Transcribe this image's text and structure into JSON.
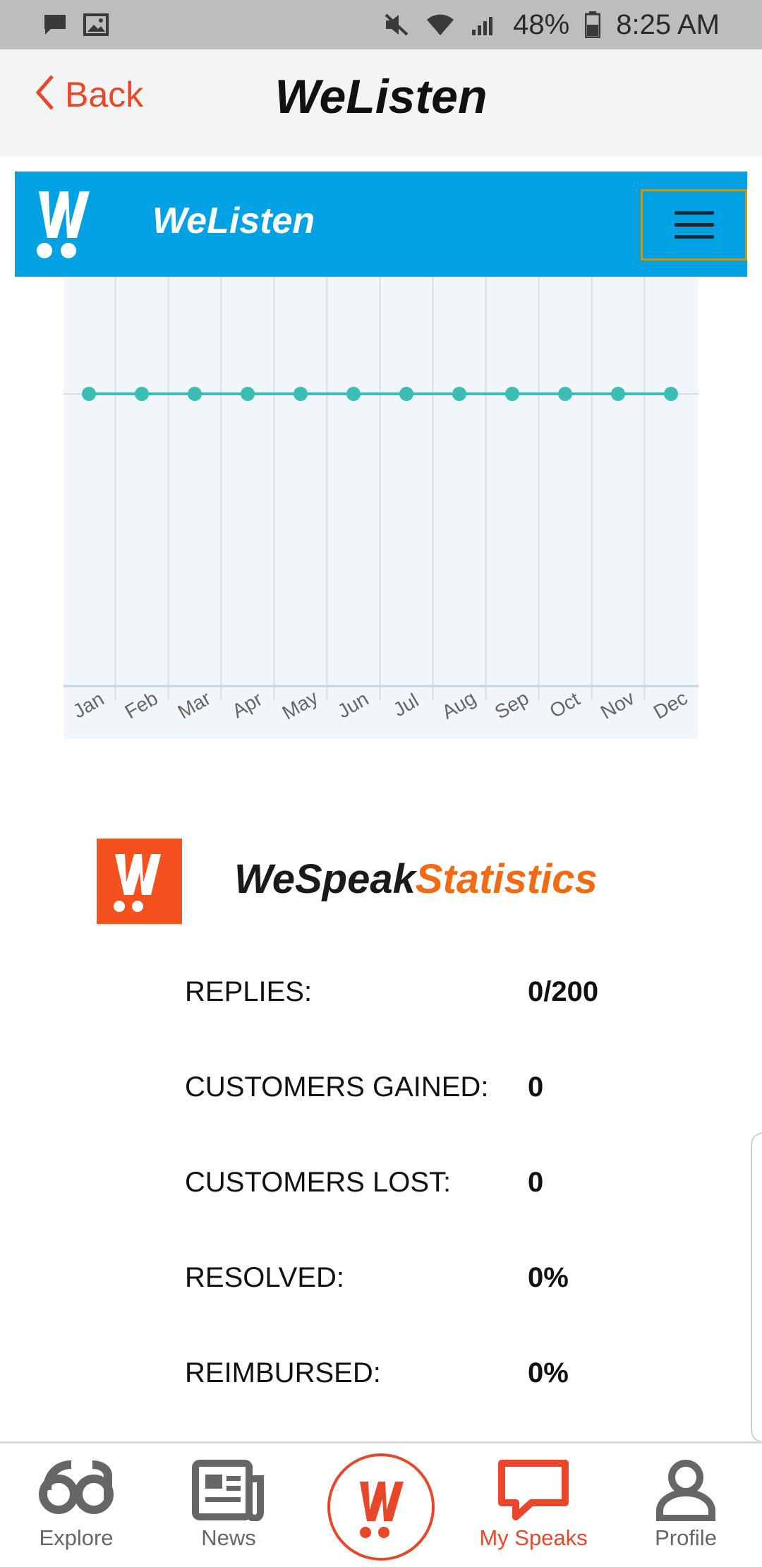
{
  "status_bar": {
    "battery": "48%",
    "time": "8:25 AM",
    "icons": [
      "message-icon",
      "image-icon",
      "mute-icon",
      "wifi-icon",
      "signal-icon",
      "battery-icon"
    ]
  },
  "header": {
    "back_label": "Back",
    "title": "WeListen"
  },
  "banner": {
    "title": "WeListen",
    "logo": "welisten-logo-icon"
  },
  "chart_data": {
    "type": "line",
    "categories": [
      "Jan",
      "Feb",
      "Mar",
      "Apr",
      "May",
      "Jun",
      "Jul",
      "Aug",
      "Sep",
      "Oct",
      "Nov",
      "Dec"
    ],
    "series": [
      {
        "values": [
          0,
          0,
          0,
          0,
          0,
          0,
          0,
          0,
          0,
          0,
          0,
          0
        ],
        "color": "#3bbdb4"
      }
    ],
    "ylim": [
      -1,
      3
    ],
    "grid": true,
    "title": "",
    "xlabel": "",
    "ylabel": ""
  },
  "stats": {
    "title_dark": "WeSpeak",
    "title_accent": "Statistics",
    "rows": [
      {
        "label": "REPLIES:",
        "value": "0/200"
      },
      {
        "label": "CUSTOMERS GAINED:",
        "value": "0"
      },
      {
        "label": "CUSTOMERS LOST:",
        "value": "0"
      },
      {
        "label": "RESOLVED:",
        "value": "0%"
      },
      {
        "label": "REIMBURSED:",
        "value": "0%"
      }
    ]
  },
  "bottom_nav": {
    "items": [
      {
        "label": "Explore",
        "icon": "explore-icon"
      },
      {
        "label": "News",
        "icon": "news-icon"
      },
      {
        "label": "",
        "icon": "wespeak-logo-icon"
      },
      {
        "label": "My Speaks",
        "icon": "speech-bubble-icon",
        "active": true
      },
      {
        "label": "Profile",
        "icon": "profile-icon"
      }
    ]
  },
  "colors": {
    "accent": "#e8472a",
    "banner_blue": "#00a2e3",
    "stats_orange": "#f26a12",
    "chart_line": "#3bbdb4"
  }
}
